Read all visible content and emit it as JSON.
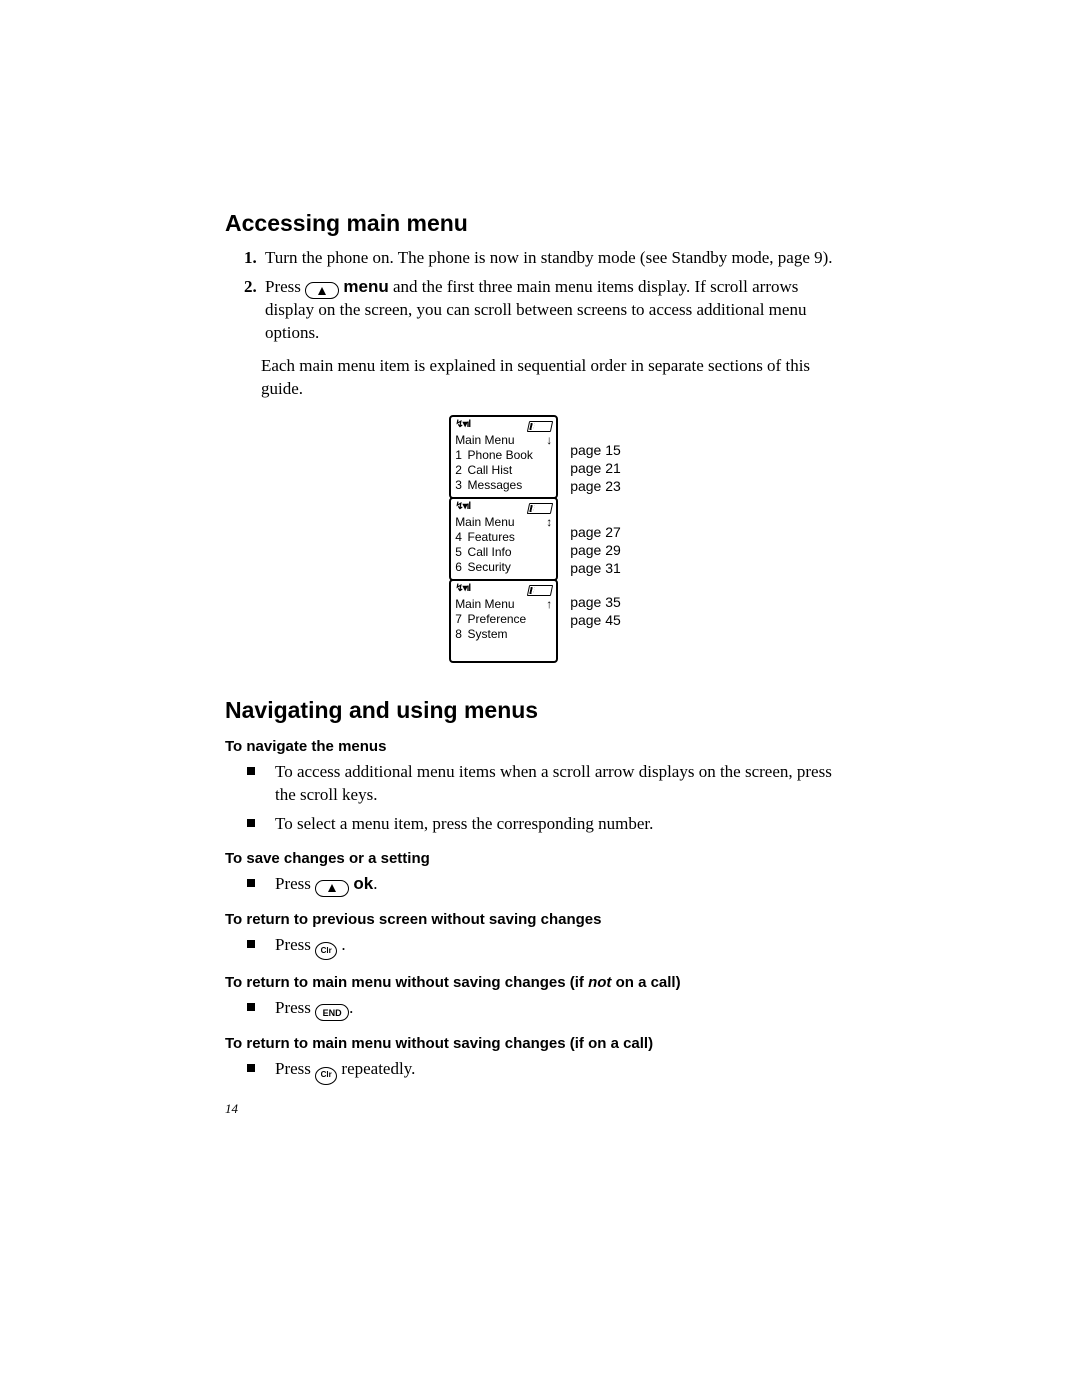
{
  "section1": {
    "heading": "Accessing main menu",
    "step1": "Turn the phone on. The phone is now in standby mode (see Standby mode, page 9).",
    "step2_before": "Press ",
    "step2_menu": "menu",
    "step2_after": " and the first three main menu items display. If scroll arrows display on the screen, you can scroll between screens to access additional menu options.",
    "followup": "Each main menu item is explained in sequential order in separate sections of this guide.",
    "screens": [
      {
        "title": "Main Menu",
        "arrow": "↓",
        "items": [
          {
            "n": "1",
            "label": "Phone Book",
            "page": "page 15"
          },
          {
            "n": "2",
            "label": "Call Hist",
            "page": "page 21"
          },
          {
            "n": "3",
            "label": "Messages",
            "page": "page 23"
          }
        ]
      },
      {
        "title": "Main Menu",
        "arrow": "↕",
        "items": [
          {
            "n": "4",
            "label": "Features",
            "page": "page 27"
          },
          {
            "n": "5",
            "label": "Call Info",
            "page": "page 29"
          },
          {
            "n": "6",
            "label": "Security",
            "page": "page 31"
          }
        ]
      },
      {
        "title": "Main Menu",
        "arrow": "↑",
        "items": [
          {
            "n": "7",
            "label": "Preference",
            "page": "page 35"
          },
          {
            "n": "8",
            "label": "System",
            "page": "page 45"
          }
        ]
      }
    ]
  },
  "section2": {
    "heading": "Navigating and using menus",
    "navigate_h": "To navigate the menus",
    "navigate": [
      "To access additional menu items when a scroll arrow displays on the screen, press the scroll keys.",
      "To select a menu item, press the corresponding number."
    ],
    "save_h": "To save changes or a setting",
    "save_press": "Press ",
    "save_ok": "ok",
    "save_period": ".",
    "ret_prev_h": "To return to previous screen without saving changes",
    "ret_prev_press": "Press ",
    "ret_prev_period": ".",
    "ret_main_notcall_h_before": "To return to main menu without saving changes (if ",
    "ret_main_notcall_h_not": "not",
    "ret_main_notcall_h_after": " on a call)",
    "ret_main_notcall_press": "Press ",
    "ret_main_notcall_period": ".",
    "ret_main_oncall_h": "To return to main menu without saving changes (if on a call)",
    "ret_main_oncall_press": "Press ",
    "ret_main_oncall_after": " repeatedly."
  },
  "keys": {
    "clr": "Clr",
    "end": "END"
  },
  "page_number": "14"
}
